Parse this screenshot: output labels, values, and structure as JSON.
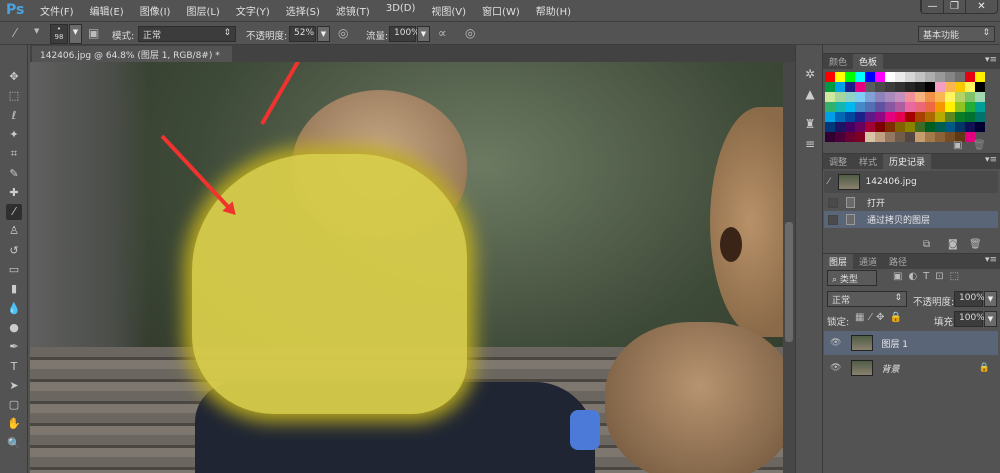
{
  "app": {
    "logo": "Ps"
  },
  "menu": [
    "文件(F)",
    "编辑(E)",
    "图像(I)",
    "图层(L)",
    "文字(Y)",
    "选择(S)",
    "滤镜(T)",
    "3D(D)",
    "视图(V)",
    "窗口(W)",
    "帮助(H)"
  ],
  "window_buttons": [
    "—",
    "❐",
    "✕"
  ],
  "options": {
    "brush_size": "98",
    "mode_label": "模式:",
    "mode_value": "正常",
    "opacity_label": "不透明度:",
    "opacity_value": "52%",
    "flow_label": "流量:",
    "flow_value": "100%",
    "workspace": "基本功能"
  },
  "document": {
    "tab_title": "142406.jpg @ 64.8% (图层 1, RGB/8#) *",
    "close": "×"
  },
  "swatch_panel": {
    "tabs": [
      "颜色",
      "色板"
    ],
    "active": 1,
    "colors": [
      "#ff0000",
      "#ffff00",
      "#00ff00",
      "#00ffff",
      "#0000ff",
      "#ff00ff",
      "#ffffff",
      "#ebebeb",
      "#d6d6d6",
      "#c2c2c2",
      "#adadad",
      "#999999",
      "#858585",
      "#707070",
      "#e60012",
      "#fff100",
      "#009944",
      "#00a0e9",
      "#1d2088",
      "#e4007f",
      "#5c5c5c",
      "#4a4a4a",
      "#3d3d3d",
      "#333333",
      "#262626",
      "#1a1a1a",
      "#000000",
      "#f19ec2",
      "#f8b551",
      "#fcc800",
      "#fff45c",
      "#000000",
      "#cfe8a0",
      "#a7d5a0",
      "#8fd3c6",
      "#7ecef4",
      "#80a0d8",
      "#8f82bc",
      "#aa89bd",
      "#c490bf",
      "#f09199",
      "#f6b37f",
      "#f19149",
      "#f8b551",
      "#fff45c",
      "#b3d465",
      "#80c269",
      "#a1d8b1",
      "#32b16c",
      "#13b5b1",
      "#00b7ee",
      "#448aca",
      "#556fb5",
      "#5f52a0",
      "#8957a1",
      "#ae5da1",
      "#ea68a2",
      "#eb6877",
      "#ec6941",
      "#f39800",
      "#fff100",
      "#8fc31f",
      "#22ac38",
      "#009e96",
      "#00a0e9",
      "#0068b7",
      "#00479d",
      "#1d2088",
      "#601986",
      "#920783",
      "#e4007f",
      "#e5004f",
      "#a40000",
      "#a84200",
      "#ac6a00",
      "#b7aa00",
      "#5f8720",
      "#097c25",
      "#007130",
      "#00736d",
      "#00397a",
      "#1b1464",
      "#440062",
      "#6a005f",
      "#a40035",
      "#7d0000",
      "#7f2d00",
      "#826200",
      "#898100",
      "#3e6b23",
      "#005e20",
      "#005e51",
      "#005982",
      "#003567",
      "#101055",
      "#000033",
      "#330033",
      "#4a0038",
      "#6a0032",
      "#7d0022",
      "#d9c3a5",
      "#c0a080",
      "#937760",
      "#705c4a",
      "#534741",
      "#c79d6e",
      "#a47a4a",
      "#8c6239",
      "#754c24",
      "#603813",
      "#e4007f"
    ]
  },
  "history_panel": {
    "tabs": [
      "调整",
      "样式",
      "历史记录"
    ],
    "active": 2,
    "snapshot": "142406.jpg",
    "items": [
      "打开",
      "通过拷贝的图层"
    ]
  },
  "layers_panel": {
    "tabs": [
      "图层",
      "通道",
      "路径"
    ],
    "filter": "类型",
    "blend": "正常",
    "opacity_label": "不透明度:",
    "opacity_value": "100%",
    "lock_label": "锁定:",
    "fill_label": "填充:",
    "fill_value": "100%",
    "layers": [
      {
        "name": "图层 1",
        "selected": true
      },
      {
        "name": "背景",
        "selected": false
      }
    ]
  }
}
